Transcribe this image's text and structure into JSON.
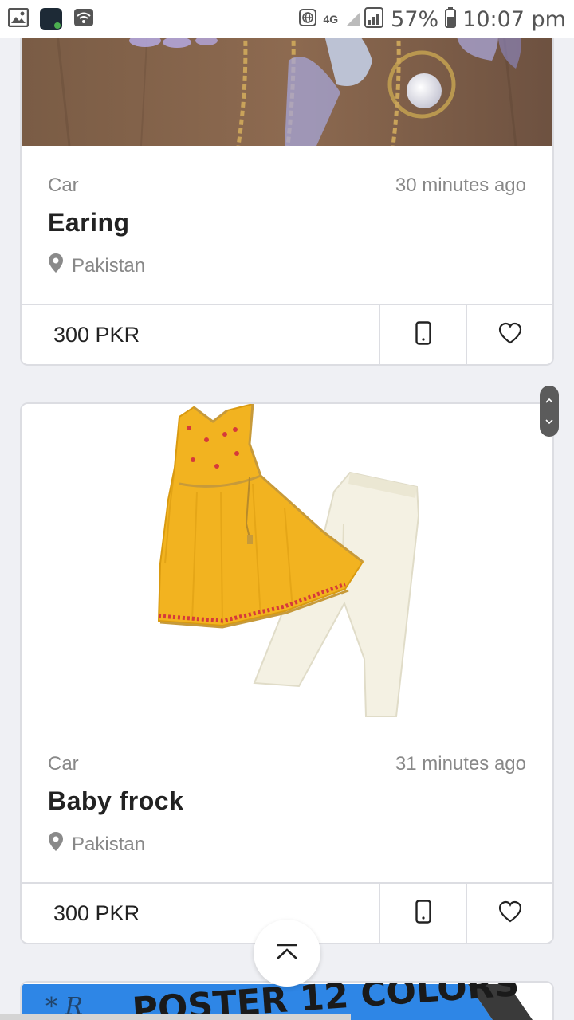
{
  "status_bar": {
    "network": "4G",
    "battery": "57%",
    "time": "10:07 pm"
  },
  "listings": [
    {
      "category": "Car",
      "time_ago": "30 minutes ago",
      "title": "Earing",
      "location": "Pakistan",
      "price": "300 PKR"
    },
    {
      "category": "Car",
      "time_ago": "31 minutes ago",
      "title": "Baby frock",
      "location": "Pakistan",
      "price": "300 PKR"
    }
  ],
  "partial_listing": {
    "image_text": "POSTER 12 COLORS"
  },
  "colors": {
    "background": "#eff0f4",
    "card_border": "#dcdde2",
    "dress_yellow": "#f2b320",
    "trouser_cream": "#f4f1e3"
  }
}
